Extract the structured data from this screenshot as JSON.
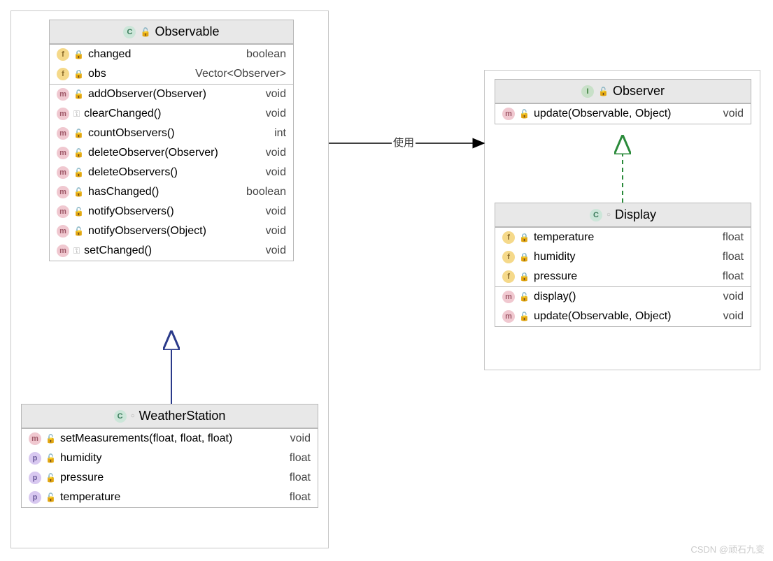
{
  "classes": {
    "observable": {
      "title": "Observable",
      "stereotype": "C",
      "fields": [
        {
          "badge": "f",
          "vis": "lock",
          "name": "changed",
          "type": "boolean"
        },
        {
          "badge": "f",
          "vis": "lock",
          "name": "obs",
          "type": "Vector<Observer>"
        }
      ],
      "methods": [
        {
          "badge": "m",
          "vis": "unlock",
          "name": "addObserver(Observer)",
          "type": "void"
        },
        {
          "badge": "m",
          "vis": "key",
          "name": "clearChanged()",
          "type": "void"
        },
        {
          "badge": "m",
          "vis": "unlock",
          "name": "countObservers()",
          "type": "int"
        },
        {
          "badge": "m",
          "vis": "unlock",
          "name": "deleteObserver(Observer)",
          "type": "void"
        },
        {
          "badge": "m",
          "vis": "unlock",
          "name": "deleteObservers()",
          "type": "void"
        },
        {
          "badge": "m",
          "vis": "unlock",
          "name": "hasChanged()",
          "type": "boolean"
        },
        {
          "badge": "m",
          "vis": "unlock",
          "name": "notifyObservers()",
          "type": "void"
        },
        {
          "badge": "m",
          "vis": "unlock",
          "name": "notifyObservers(Object)",
          "type": "void"
        },
        {
          "badge": "m",
          "vis": "key",
          "name": "setChanged()",
          "type": "void"
        }
      ]
    },
    "weatherstation": {
      "title": "WeatherStation",
      "stereotype": "C",
      "members": [
        {
          "badge": "m",
          "vis": "unlock",
          "name": "setMeasurements(float, float, float)",
          "type": "void"
        },
        {
          "badge": "p",
          "vis": "unlock",
          "name": "humidity",
          "type": "float"
        },
        {
          "badge": "p",
          "vis": "unlock",
          "name": "pressure",
          "type": "float"
        },
        {
          "badge": "p",
          "vis": "unlock",
          "name": "temperature",
          "type": "float"
        }
      ]
    },
    "observer": {
      "title": "Observer",
      "stereotype": "I",
      "methods": [
        {
          "badge": "m",
          "vis": "unlock",
          "name": "update(Observable, Object)",
          "type": "void"
        }
      ]
    },
    "display": {
      "title": "Display",
      "stereotype": "C",
      "fields": [
        {
          "badge": "f",
          "vis": "lock",
          "name": "temperature",
          "type": "float"
        },
        {
          "badge": "f",
          "vis": "lock",
          "name": "humidity",
          "type": "float"
        },
        {
          "badge": "f",
          "vis": "lock",
          "name": "pressure",
          "type": "float"
        }
      ],
      "methods": [
        {
          "badge": "m",
          "vis": "unlock",
          "name": "display()",
          "type": "void"
        },
        {
          "badge": "m",
          "vis": "unlock",
          "name": "update(Observable, Object)",
          "type": "void"
        }
      ]
    }
  },
  "connections": {
    "uses_label": "使用"
  },
  "watermark": "CSDN @顽石九变"
}
